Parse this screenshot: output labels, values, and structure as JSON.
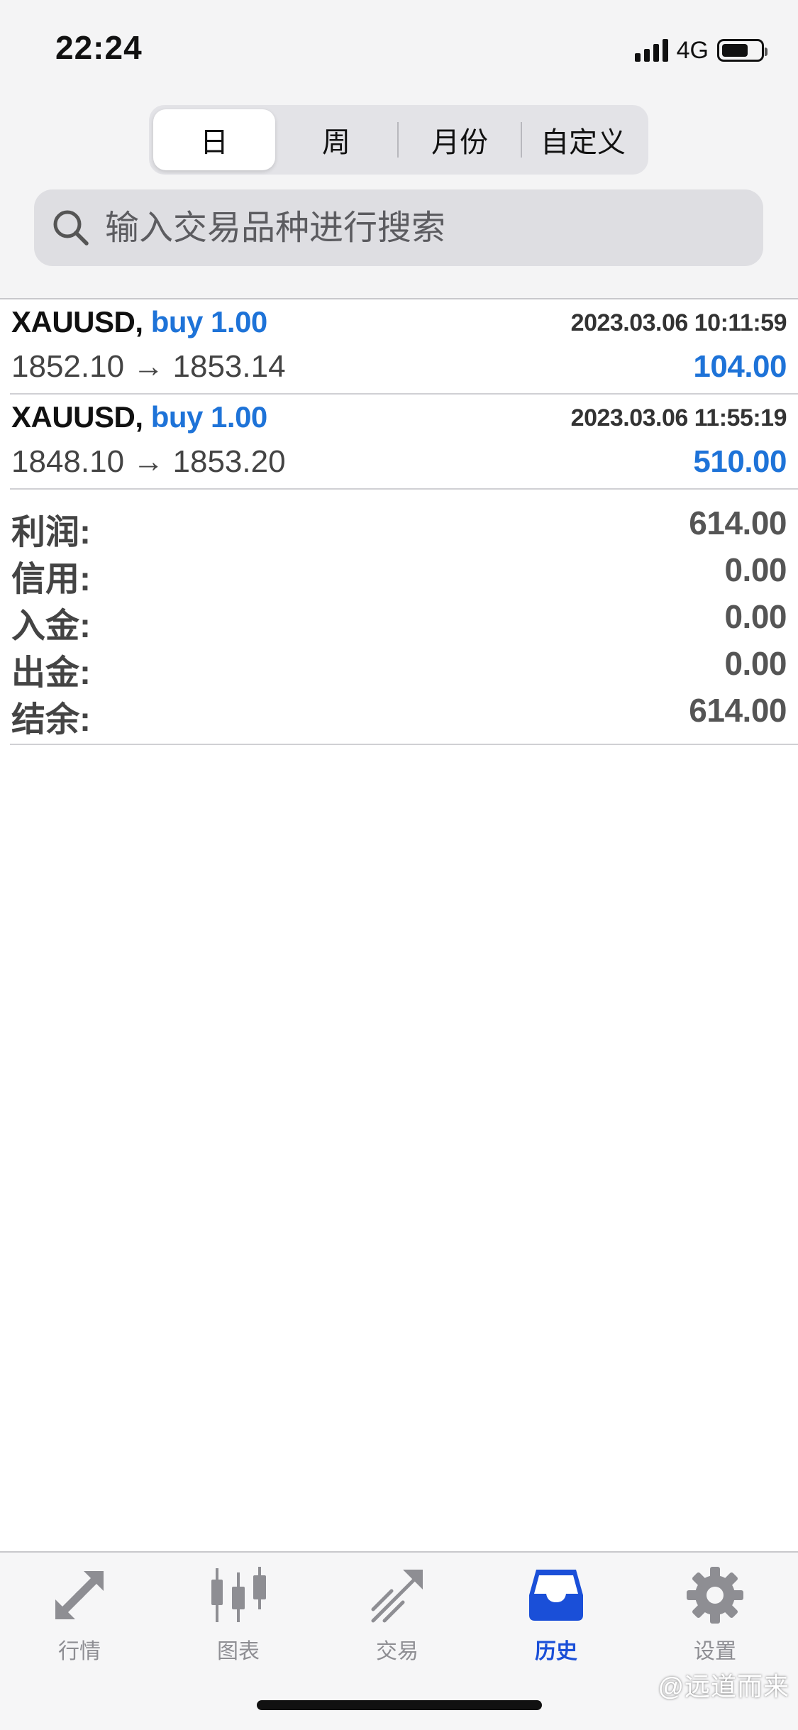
{
  "status_bar": {
    "time": "22:24",
    "network": "4G",
    "battery_level": 0.7
  },
  "period_tabs": [
    {
      "label": "日",
      "active": true
    },
    {
      "label": "周",
      "active": false
    },
    {
      "label": "月份",
      "active": false
    },
    {
      "label": "自定义",
      "active": false
    }
  ],
  "search": {
    "placeholder": "输入交易品种进行搜索",
    "icon": "magnifier-icon"
  },
  "trades": [
    {
      "symbol": "XAUUSD,",
      "side": "buy 1.00",
      "time": "2023.03.06 10:11:59",
      "prices": "1852.10 → 1853.14",
      "profit": "104.00"
    },
    {
      "symbol": "XAUUSD,",
      "side": "buy 1.00",
      "time": "2023.03.06 11:55:19",
      "prices": "1848.10 → 1853.20",
      "profit": "510.00"
    }
  ],
  "summary": [
    {
      "label": "利润:",
      "value": "614.00"
    },
    {
      "label": "信用:",
      "value": "0.00"
    },
    {
      "label": "入金:",
      "value": "0.00"
    },
    {
      "label": "出金:",
      "value": "0.00"
    },
    {
      "label": "结余:",
      "value": "614.00"
    }
  ],
  "tab_bar": [
    {
      "label": "行情",
      "icon": "quotes-arrows-icon",
      "active": false
    },
    {
      "label": "图表",
      "icon": "candlestick-icon",
      "active": false
    },
    {
      "label": "交易",
      "icon": "trade-trend-icon",
      "active": false
    },
    {
      "label": "历史",
      "icon": "history-inbox-icon",
      "active": true
    },
    {
      "label": "设置",
      "icon": "gear-icon",
      "active": false
    }
  ],
  "watermark": "@远道而来",
  "colors": {
    "accent_blue": "#1e73d8",
    "active_tab": "#1a4fd8",
    "inactive_tab": "#8e8e93"
  }
}
